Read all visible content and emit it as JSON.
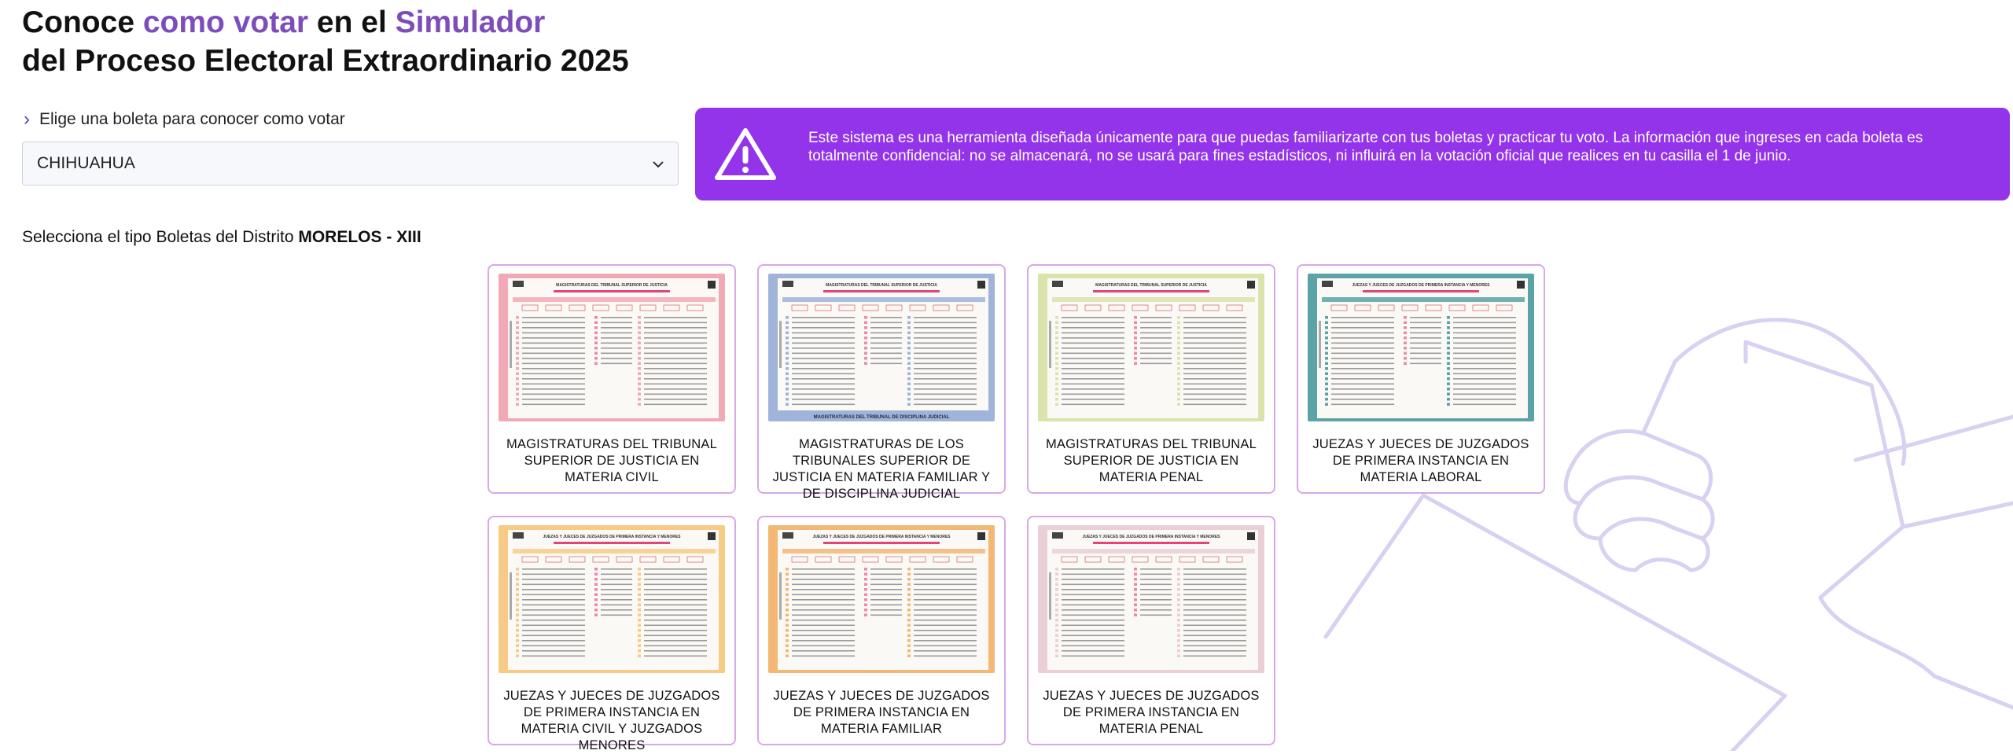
{
  "page": {
    "title_line1_part1": "Conoce",
    "title_line1_part2": "como votar",
    "title_line1_part3": "en el",
    "title_line1_part4": "Simulador",
    "title_line2": "del Proceso Electoral Extraordinario 2025"
  },
  "chooser": {
    "label": "Elige una boleta para conocer como votar",
    "selected": "CHIHUAHUA"
  },
  "alert": {
    "text": "Este sistema es una herramienta diseñada únicamente para que puedas familiarizarte con tus boletas y practicar tu voto. La información que ingreses en cada boleta es totalmente confidencial: no se almacenará, no se usará para fines estadísticos, ni influirá en la votación oficial que realices en tu casilla el 1 de junio."
  },
  "district": {
    "prefix": "Selecciona el tipo Boletas del Distrito",
    "name": "MORELOS - XIII"
  },
  "ballots": [
    {
      "label": "MAGISTRATURAS DEL TRIBUNAL SUPERIOR DE JUSTICIA EN MATERIA CIVIL",
      "color": "#f2a9b6",
      "header": "MAGISTRATURAS DEL TRIBUNAL SUPERIOR DE JUSTICIA"
    },
    {
      "label": "MAGISTRATURAS DE LOS TRIBUNALES SUPERIOR DE JUSTICIA EN MATERIA FAMILIAR Y DE DISCIPLINA JUDICIAL",
      "color": "#9fb4d8",
      "header": "MAGISTRATURAS DEL TRIBUNAL SUPERIOR DE JUSTICIA",
      "footer": "MAGISTRATURAS DEL TRIBUNAL DE DISCIPLINA JUDICIAL"
    },
    {
      "label": "MAGISTRATURAS DEL TRIBUNAL SUPERIOR DE JUSTICIA EN MATERIA PENAL",
      "color": "#dbe3ad",
      "header": "MAGISTRATURAS DEL TRIBUNAL SUPERIOR DE JUSTICIA"
    },
    {
      "label": "JUEZAS Y JUECES DE JUZGADOS DE PRIMERA INSTANCIA EN MATERIA LABORAL",
      "color": "#5aa3a6",
      "header": "JUEZAS Y JUECES DE JUZGADOS DE PRIMERA INSTANCIA Y MENORES"
    },
    {
      "label": "JUEZAS Y JUECES DE JUZGADOS DE PRIMERA INSTANCIA EN MATERIA CIVIL Y JUZGADOS MENORES",
      "color": "#f7cb86",
      "header": "JUEZAS Y JUECES DE JUZGADOS DE PRIMERA INSTANCIA Y MENORES"
    },
    {
      "label": "JUEZAS Y JUECES DE JUZGADOS DE PRIMERA INSTANCIA EN MATERIA FAMILIAR",
      "color": "#f2b874",
      "header": "JUEZAS Y JUECES DE JUZGADOS DE PRIMERA INSTANCIA Y MENORES"
    },
    {
      "label": "JUEZAS Y JUECES DE JUZGADOS DE PRIMERA INSTANCIA EN MATERIA PENAL",
      "color": "#ead0d6",
      "header": "JUEZAS Y JUECES DE JUZGADOS DE PRIMERA INSTANCIA Y MENORES"
    }
  ],
  "colors": {
    "accent": "#7c4dbb",
    "alert_bg": "#9333ea",
    "card_border": "#d7a8e6"
  },
  "icons": {
    "chooser": "chevron-right-icon",
    "select": "chevron-down-icon",
    "alert": "warning-triangle-icon",
    "background": "hand-voting-illustration"
  }
}
